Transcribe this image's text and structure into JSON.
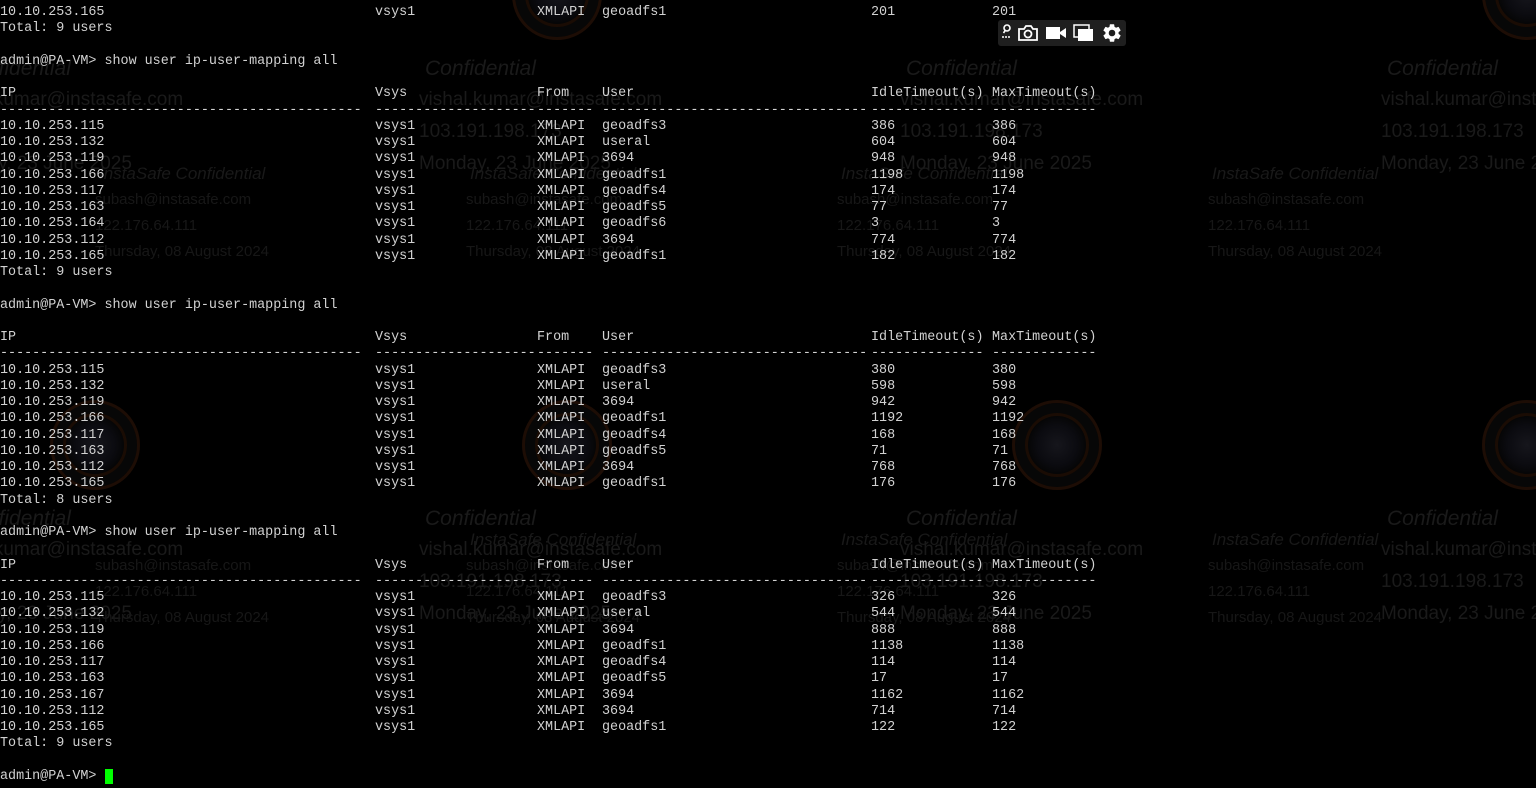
{
  "watermarks": {
    "confidential": "Confidential",
    "user_email_1": "vishal.kumar@instasafe.com",
    "user_ip_1": "103.191.198.173",
    "user_date_1": "Monday, 23 June 2025",
    "insta_label": "InstaSafe Confidential",
    "user_email_2": "subash@instasafe.com",
    "user_ip_2": "122.176.64.111",
    "user_date_2": "Thursday, 08 August 2024"
  },
  "toolbar": {
    "icons": [
      "pin-icon",
      "camera-icon",
      "video-icon",
      "windows-icon",
      "gear-icon"
    ]
  },
  "colors": {
    "background": "#000000",
    "text": "#d2d2d2",
    "cursor": "#00ff00"
  },
  "lines": [
    {
      "t": "row",
      "c": [
        "10.10.253.165",
        "vsys1",
        "XMLAPI",
        "geoadfs1",
        "201",
        "201"
      ]
    },
    {
      "t": "text",
      "v": "Total: 9 users"
    },
    {
      "t": "blank"
    },
    {
      "t": "text",
      "v": "admin@PA-VM> show user ip-user-mapping all"
    },
    {
      "t": "blank"
    },
    {
      "t": "row",
      "c": [
        "IP",
        "Vsys",
        "From",
        "User",
        "IdleTimeout(s)",
        "MaxTimeout(s)"
      ]
    },
    {
      "t": "row",
      "c": [
        "---------------------------------------------",
        "--------------------",
        "-------",
        "---------------------------------",
        "--------------",
        "-------------"
      ]
    },
    {
      "t": "row",
      "c": [
        "10.10.253.115",
        "vsys1",
        "XMLAPI",
        "geoadfs3",
        "386",
        "386"
      ]
    },
    {
      "t": "row",
      "c": [
        "10.10.253.132",
        "vsys1",
        "XMLAPI",
        "useral",
        "604",
        "604"
      ]
    },
    {
      "t": "row",
      "c": [
        "10.10.253.119",
        "vsys1",
        "XMLAPI",
        "3694",
        "948",
        "948"
      ]
    },
    {
      "t": "row",
      "c": [
        "10.10.253.166",
        "vsys1",
        "XMLAPI",
        "geoadfs1",
        "1198",
        "1198"
      ]
    },
    {
      "t": "row",
      "c": [
        "10.10.253.117",
        "vsys1",
        "XMLAPI",
        "geoadfs4",
        "174",
        "174"
      ]
    },
    {
      "t": "row",
      "c": [
        "10.10.253.163",
        "vsys1",
        "XMLAPI",
        "geoadfs5",
        "77",
        "77"
      ]
    },
    {
      "t": "row",
      "c": [
        "10.10.253.164",
        "vsys1",
        "XMLAPI",
        "geoadfs6",
        "3",
        "3"
      ]
    },
    {
      "t": "row",
      "c": [
        "10.10.253.112",
        "vsys1",
        "XMLAPI",
        "3694",
        "774",
        "774"
      ]
    },
    {
      "t": "row",
      "c": [
        "10.10.253.165",
        "vsys1",
        "XMLAPI",
        "geoadfs1",
        "182",
        "182"
      ]
    },
    {
      "t": "text",
      "v": "Total: 9 users"
    },
    {
      "t": "blank"
    },
    {
      "t": "text",
      "v": "admin@PA-VM> show user ip-user-mapping all"
    },
    {
      "t": "blank"
    },
    {
      "t": "row",
      "c": [
        "IP",
        "Vsys",
        "From",
        "User",
        "IdleTimeout(s)",
        "MaxTimeout(s)"
      ]
    },
    {
      "t": "row",
      "c": [
        "---------------------------------------------",
        "--------------------",
        "-------",
        "---------------------------------",
        "--------------",
        "-------------"
      ]
    },
    {
      "t": "row",
      "c": [
        "10.10.253.115",
        "vsys1",
        "XMLAPI",
        "geoadfs3",
        "380",
        "380"
      ]
    },
    {
      "t": "row",
      "c": [
        "10.10.253.132",
        "vsys1",
        "XMLAPI",
        "useral",
        "598",
        "598"
      ]
    },
    {
      "t": "row",
      "c": [
        "10.10.253.119",
        "vsys1",
        "XMLAPI",
        "3694",
        "942",
        "942"
      ]
    },
    {
      "t": "row",
      "c": [
        "10.10.253.166",
        "vsys1",
        "XMLAPI",
        "geoadfs1",
        "1192",
        "1192"
      ]
    },
    {
      "t": "row",
      "c": [
        "10.10.253.117",
        "vsys1",
        "XMLAPI",
        "geoadfs4",
        "168",
        "168"
      ]
    },
    {
      "t": "row",
      "c": [
        "10.10.253.163",
        "vsys1",
        "XMLAPI",
        "geoadfs5",
        "71",
        "71"
      ]
    },
    {
      "t": "row",
      "c": [
        "10.10.253.112",
        "vsys1",
        "XMLAPI",
        "3694",
        "768",
        "768"
      ]
    },
    {
      "t": "row",
      "c": [
        "10.10.253.165",
        "vsys1",
        "XMLAPI",
        "geoadfs1",
        "176",
        "176"
      ]
    },
    {
      "t": "text",
      "v": "Total: 8 users"
    },
    {
      "t": "blank"
    },
    {
      "t": "text",
      "v": "admin@PA-VM> show user ip-user-mapping all"
    },
    {
      "t": "blank"
    },
    {
      "t": "row",
      "c": [
        "IP",
        "Vsys",
        "From",
        "User",
        "IdleTimeout(s)",
        "MaxTimeout(s)"
      ]
    },
    {
      "t": "row",
      "c": [
        "---------------------------------------------",
        "--------------------",
        "-------",
        "---------------------------------",
        "--------------",
        "-------------"
      ]
    },
    {
      "t": "row",
      "c": [
        "10.10.253.115",
        "vsys1",
        "XMLAPI",
        "geoadfs3",
        "326",
        "326"
      ]
    },
    {
      "t": "row",
      "c": [
        "10.10.253.132",
        "vsys1",
        "XMLAPI",
        "useral",
        "544",
        "544"
      ]
    },
    {
      "t": "row",
      "c": [
        "10.10.253.119",
        "vsys1",
        "XMLAPI",
        "3694",
        "888",
        "888"
      ]
    },
    {
      "t": "row",
      "c": [
        "10.10.253.166",
        "vsys1",
        "XMLAPI",
        "geoadfs1",
        "1138",
        "1138"
      ]
    },
    {
      "t": "row",
      "c": [
        "10.10.253.117",
        "vsys1",
        "XMLAPI",
        "geoadfs4",
        "114",
        "114"
      ]
    },
    {
      "t": "row",
      "c": [
        "10.10.253.163",
        "vsys1",
        "XMLAPI",
        "geoadfs5",
        "17",
        "17"
      ]
    },
    {
      "t": "row",
      "c": [
        "10.10.253.167",
        "vsys1",
        "XMLAPI",
        "3694",
        "1162",
        "1162"
      ]
    },
    {
      "t": "row",
      "c": [
        "10.10.253.112",
        "vsys1",
        "XMLAPI",
        "3694",
        "714",
        "714"
      ]
    },
    {
      "t": "row",
      "c": [
        "10.10.253.165",
        "vsys1",
        "XMLAPI",
        "geoadfs1",
        "122",
        "122"
      ]
    },
    {
      "t": "text",
      "v": "Total: 9 users"
    },
    {
      "t": "blank"
    },
    {
      "t": "prompt",
      "v": "admin@PA-VM> "
    }
  ]
}
